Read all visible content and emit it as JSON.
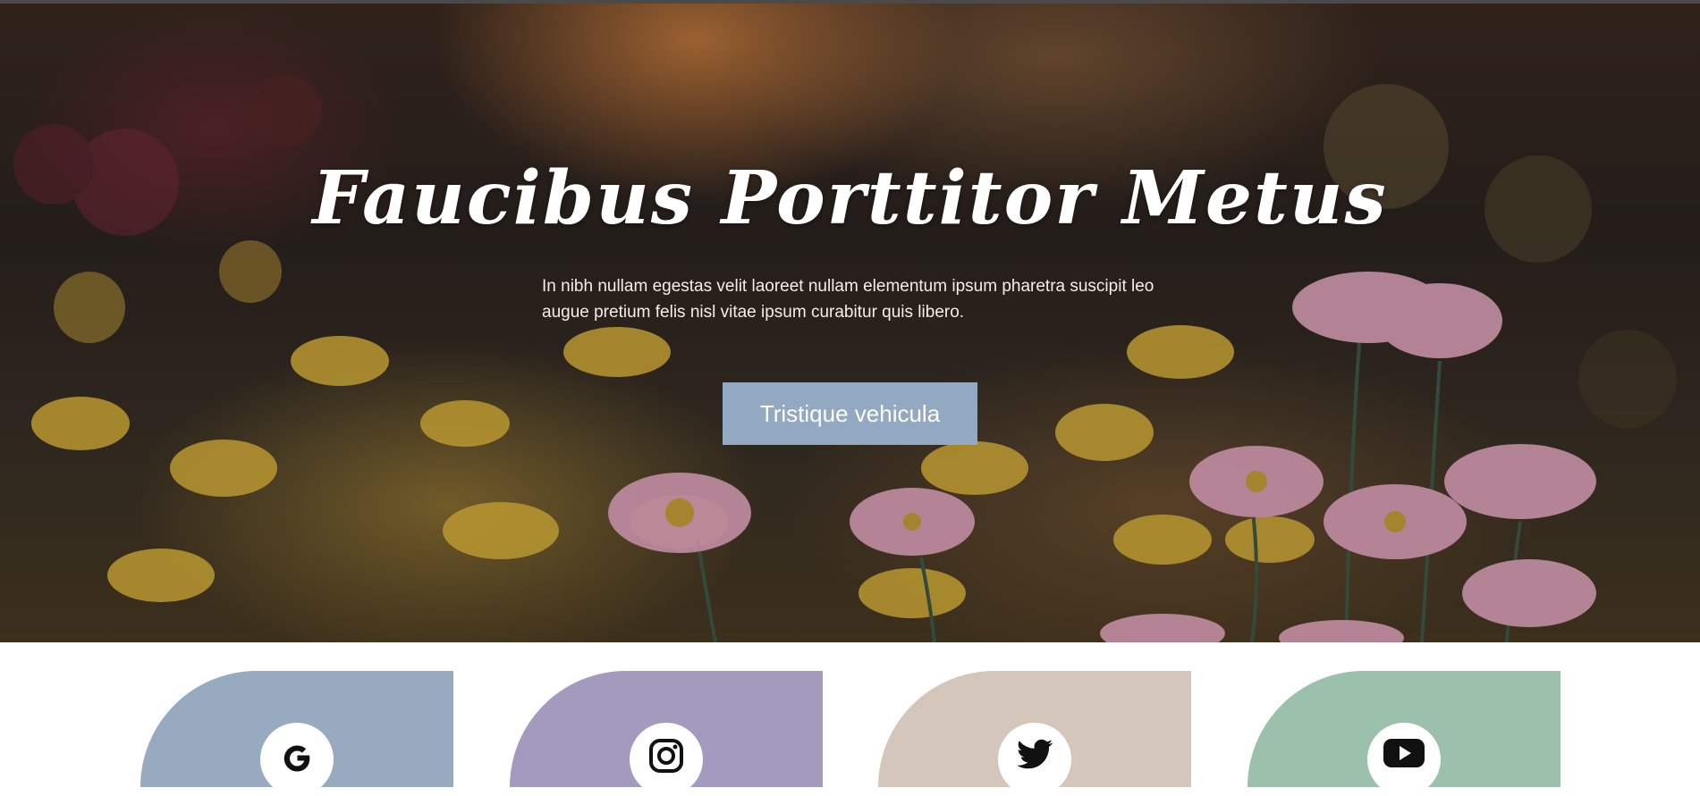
{
  "hero": {
    "title": "Faucibus Porttitor Metus",
    "text": "In nibh nullam egestas velit laoreet nullam elementum ipsum pharetra suscipit leo augue pretium felis nisl vitae ipsum curabitur quis libero.",
    "button_label": "Tristique vehicula"
  },
  "colors": {
    "button": "#93a8c1",
    "google_card": "#97aac0",
    "instagram_card": "#a39abe",
    "twitter_card": "#d4c6ba",
    "youtube_card": "#9bc1ad"
  },
  "social_cards": [
    {
      "name": "google",
      "icon": "google-icon"
    },
    {
      "name": "instagram",
      "icon": "instagram-icon"
    },
    {
      "name": "twitter",
      "icon": "twitter-icon"
    },
    {
      "name": "youtube",
      "icon": "youtube-icon"
    }
  ]
}
